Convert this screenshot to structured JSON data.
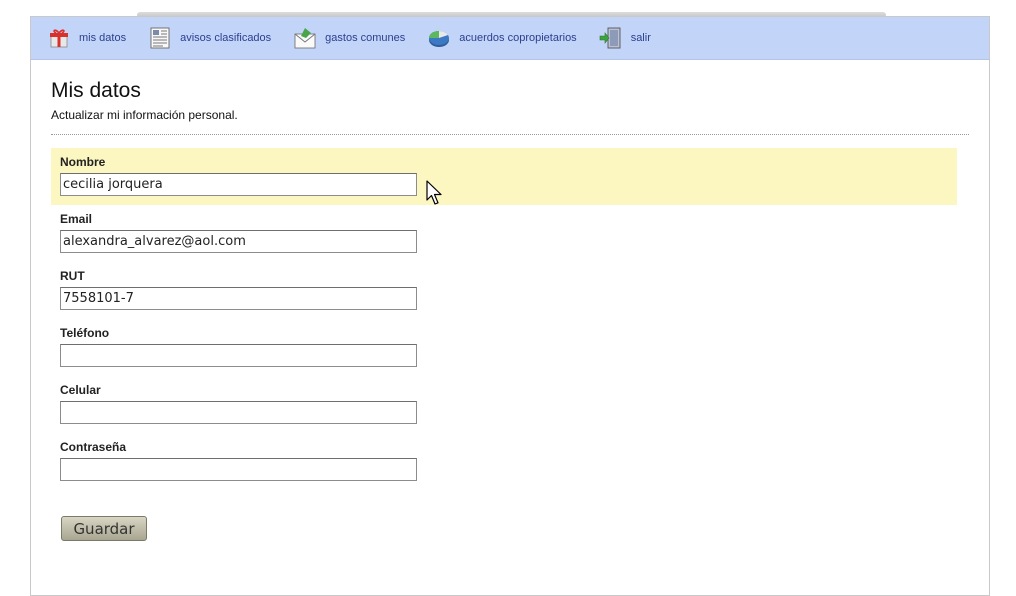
{
  "nav": {
    "items": [
      {
        "label": "mis datos",
        "icon": "gift-box-icon"
      },
      {
        "label": "avisos clasificados",
        "icon": "newspaper-icon"
      },
      {
        "label": "gastos comunes",
        "icon": "envelope-icon"
      },
      {
        "label": "acuerdos copropietarios",
        "icon": "pie-chart-icon"
      },
      {
        "label": "salir",
        "icon": "exit-door-icon"
      }
    ]
  },
  "page": {
    "title": "Mis datos",
    "subtitle": "Actualizar mi información personal."
  },
  "form": {
    "fields": [
      {
        "label": "Nombre",
        "value": "cecilia jorquera"
      },
      {
        "label": "Email",
        "value": "alexandra_alvarez@aol.com"
      },
      {
        "label": "RUT",
        "value": "7558101-7"
      },
      {
        "label": "Teléfono",
        "value": ""
      },
      {
        "label": "Celular",
        "value": ""
      },
      {
        "label": "Contraseña",
        "value": ""
      }
    ],
    "save_label": "Guardar"
  },
  "colors": {
    "navbar_bg": "#c3d4f9",
    "nav_link": "#2a3f8f",
    "active_field_bg": "#fcf6c0"
  }
}
